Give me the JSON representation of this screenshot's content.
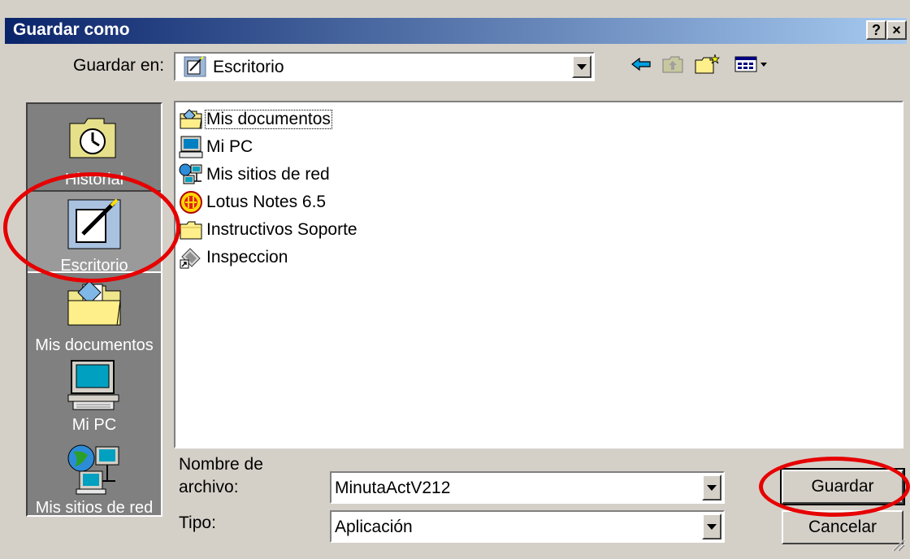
{
  "window": {
    "title": "Guardar como",
    "help_glyph": "?",
    "close_glyph": "×"
  },
  "toolbar": {
    "save_in_label": "Guardar en:",
    "save_in_value": "Escritorio",
    "icons": [
      "back-arrow-icon",
      "up-folder-icon",
      "new-folder-icon",
      "view-menu-icon"
    ]
  },
  "places": [
    {
      "label": "Historial",
      "icon": "history-icon"
    },
    {
      "label": "Escritorio",
      "icon": "desktop-icon",
      "selected": true
    },
    {
      "label": "Mis documentos",
      "icon": "my-documents-icon"
    },
    {
      "label": "Mi PC",
      "icon": "my-computer-icon"
    },
    {
      "label": "Mis sitios de red",
      "icon": "network-places-icon"
    }
  ],
  "files": [
    {
      "name": "Mis documentos",
      "icon": "my-documents-icon",
      "focused": true
    },
    {
      "name": "Mi PC",
      "icon": "my-computer-icon"
    },
    {
      "name": "Mis sitios de red",
      "icon": "network-places-icon"
    },
    {
      "name": "Lotus Notes 6.5",
      "icon": "lotus-notes-icon"
    },
    {
      "name": "Instructivos Soporte",
      "icon": "folder-icon"
    },
    {
      "name": "Inspeccion",
      "icon": "shortcut-icon"
    }
  ],
  "form": {
    "filename_label_line1": "Nombre de",
    "filename_label_line2": "archivo:",
    "filename_value": "MinutaActV212",
    "type_label": "Tipo:",
    "type_value": "Aplicación"
  },
  "buttons": {
    "save": "Guardar",
    "cancel": "Cancelar"
  },
  "colors": {
    "titlebar_start": "#0a246a",
    "titlebar_end": "#a6caf0",
    "annotation": "#e60000",
    "face": "#d4d0c8"
  }
}
